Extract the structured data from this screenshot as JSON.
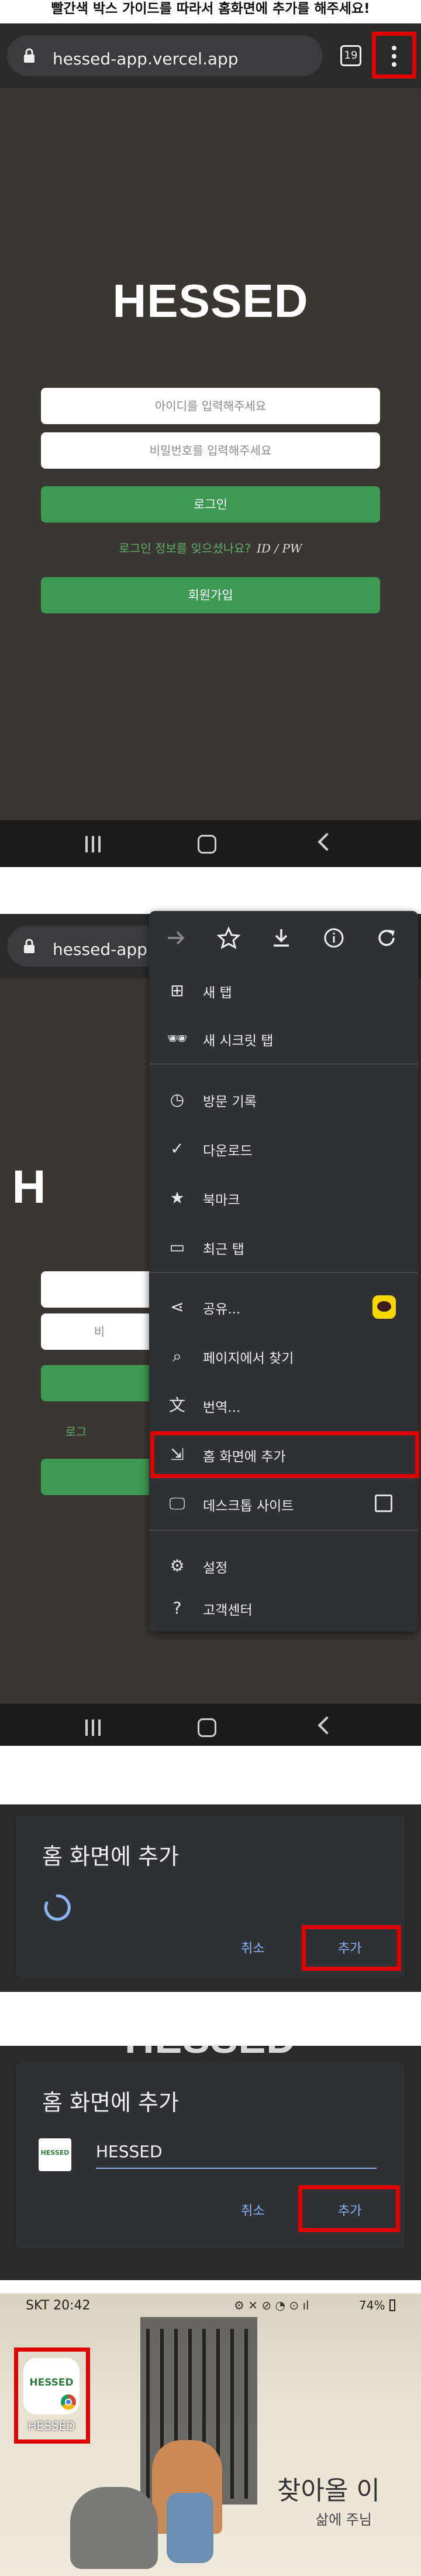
{
  "instruction": "빨간색 박스 가이드를 따라서 홈화면에 추가를 해주세요!",
  "browser": {
    "url": "hessed-app.vercel.app",
    "url_short": "hessed-app.ve",
    "tab_count": "19"
  },
  "login": {
    "logo": "HESSED",
    "id_placeholder": "아이디를 입력해주세요",
    "pw_placeholder": "비밀번호를 입력해주세요",
    "login_button": "로그인",
    "forgot_text": "로그인 정보를 잊으셨나요?",
    "forgot_link": "ID / PW",
    "signup_button": "회원가입",
    "id_partial": "",
    "pw_partial": "비",
    "forgot_partial": "로그"
  },
  "menu": {
    "items": [
      {
        "label": "새 탭",
        "icon": "plus-box-icon"
      },
      {
        "label": "새 시크릿 탭",
        "icon": "incognito-icon"
      },
      {
        "label": "방문 기록",
        "icon": "history-icon"
      },
      {
        "label": "다운로드",
        "icon": "download-check-icon"
      },
      {
        "label": "북마크",
        "icon": "star-icon"
      },
      {
        "label": "최근 탭",
        "icon": "devices-icon"
      },
      {
        "label": "공유...",
        "icon": "share-icon"
      },
      {
        "label": "페이지에서 찾기",
        "icon": "find-in-page-icon"
      },
      {
        "label": "번역...",
        "icon": "translate-icon"
      },
      {
        "label": "홈 화면에 추가",
        "icon": "add-to-home-icon"
      },
      {
        "label": "데스크톱 사이트",
        "icon": "desktop-icon"
      },
      {
        "label": "설정",
        "icon": "gear-icon"
      },
      {
        "label": "고객센터",
        "icon": "help-icon"
      }
    ]
  },
  "dialog1": {
    "title": "홈 화면에 추가",
    "cancel": "취소",
    "add": "추가"
  },
  "dialog2": {
    "title": "홈 화면에 추가",
    "app_name": "HESSED",
    "icon_text": "HESSED",
    "cancel": "취소",
    "add": "추가"
  },
  "homescreen": {
    "carrier_time": "SKT 20:42",
    "battery": "74%",
    "icon_text": "HESSED",
    "icon_label": "HESSED",
    "wallpaper_text_1": "찾아올 이",
    "wallpaper_text_2": "삶에 주님"
  },
  "colors": {
    "highlight": "#e00000",
    "green": "#3d9a52",
    "link_blue": "#8ab4f8"
  }
}
